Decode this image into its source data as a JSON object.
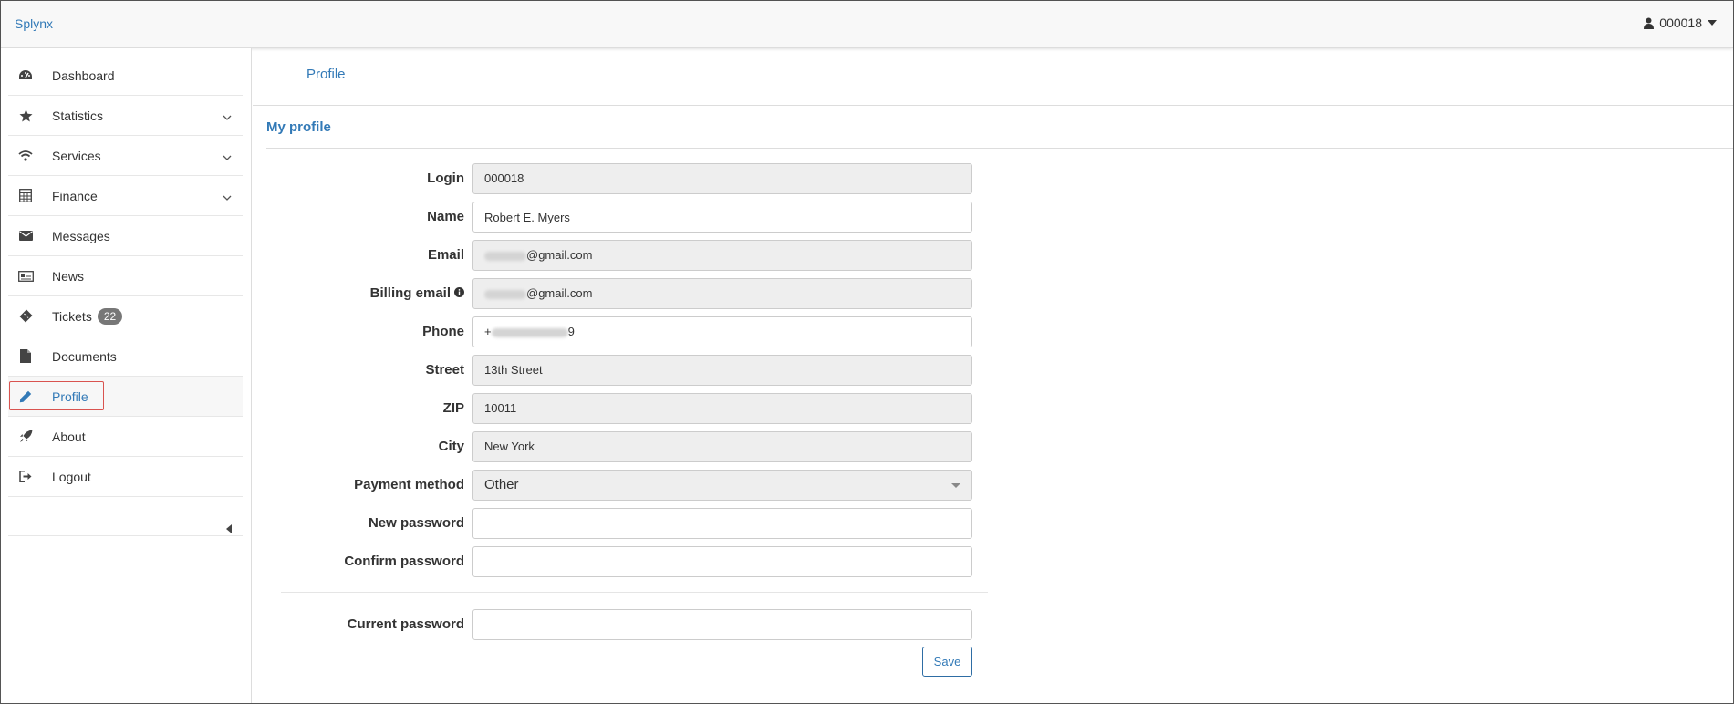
{
  "brand": "Splynx",
  "user_menu": {
    "label": "000018",
    "icon": "user-icon"
  },
  "sidebar": {
    "items": [
      {
        "label": "Dashboard",
        "icon": "dashboard-icon"
      },
      {
        "label": "Statistics",
        "icon": "star-icon",
        "expandable": true
      },
      {
        "label": "Services",
        "icon": "wifi-icon",
        "expandable": true
      },
      {
        "label": "Finance",
        "icon": "calculator-icon",
        "expandable": true
      },
      {
        "label": "Messages",
        "icon": "envelope-icon"
      },
      {
        "label": "News",
        "icon": "newspaper-icon"
      },
      {
        "label": "Tickets",
        "icon": "ticket-icon",
        "badge": "22"
      },
      {
        "label": "Documents",
        "icon": "file-icon"
      },
      {
        "label": "Profile",
        "icon": "pencil-icon",
        "active": true
      },
      {
        "label": "About",
        "icon": "rocket-icon"
      },
      {
        "label": "Logout",
        "icon": "sign-out-icon"
      }
    ]
  },
  "tabs": {
    "profile": "Profile"
  },
  "panel": {
    "title": "My profile"
  },
  "form": {
    "login": {
      "label": "Login",
      "value": "000018"
    },
    "name": {
      "label": "Name",
      "value": "Robert E. Myers"
    },
    "email": {
      "label": "Email",
      "value_suffix": "@gmail.com"
    },
    "billing_email": {
      "label": "Billing email",
      "value_suffix": "@gmail.com"
    },
    "phone": {
      "label": "Phone",
      "value_prefix": "+",
      "value_suffix": "9"
    },
    "street": {
      "label": "Street",
      "value": "13th Street"
    },
    "zip": {
      "label": "ZIP",
      "value": "10011"
    },
    "city": {
      "label": "City",
      "value": "New York"
    },
    "payment_method": {
      "label": "Payment method",
      "value": "Other"
    },
    "new_password": {
      "label": "New password",
      "value": ""
    },
    "confirm_password": {
      "label": "Confirm password",
      "value": ""
    },
    "current_password": {
      "label": "Current password",
      "value": ""
    },
    "save_label": "Save"
  },
  "colors": {
    "accent": "#337ab7",
    "highlight": "#d9534f",
    "badge": "#777777"
  }
}
